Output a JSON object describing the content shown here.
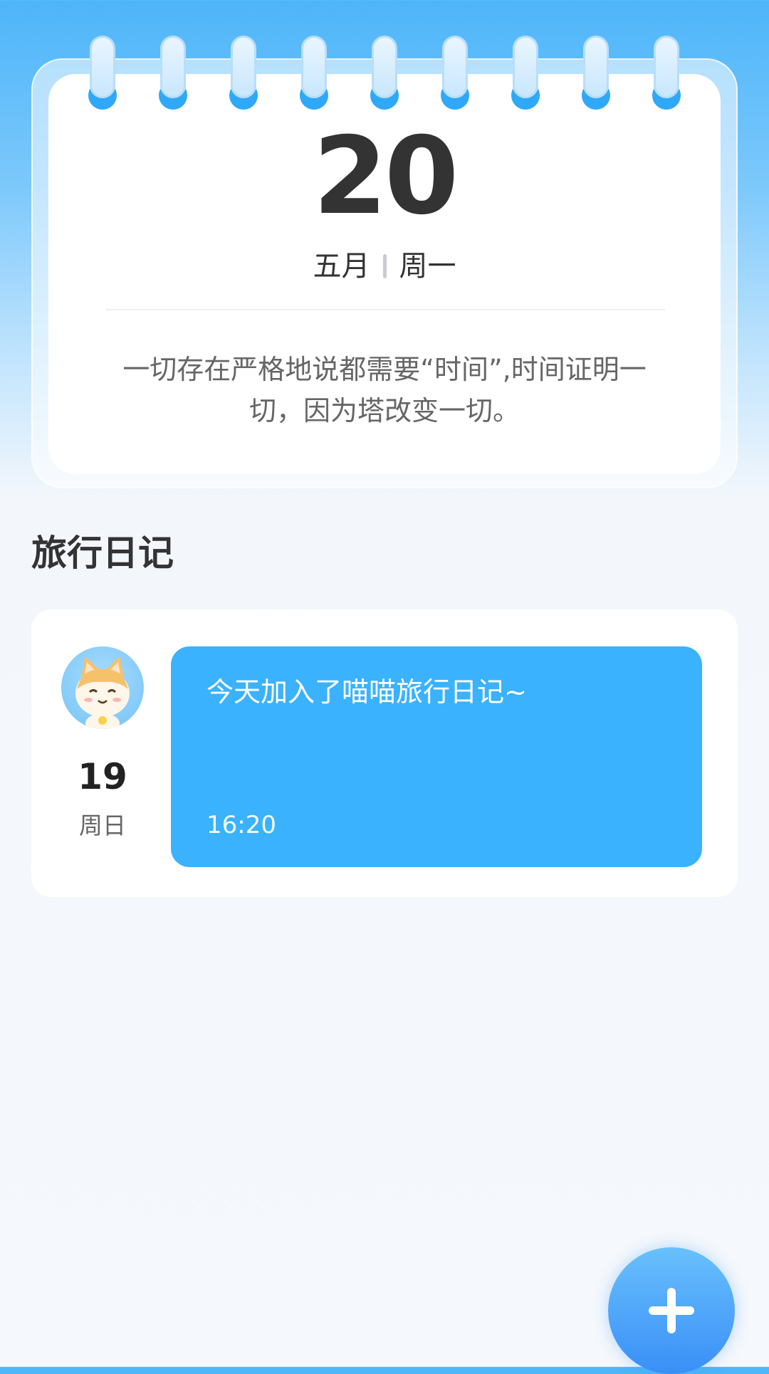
{
  "calendar": {
    "day": "20",
    "month": "五月",
    "weekday": "周一",
    "quote_line1": "一切存在严格地说都需要“时间”,时间证明一",
    "quote_line2": "切，因为塔改变一切。"
  },
  "diary": {
    "section_title": "旅行日记",
    "entries": [
      {
        "day": "19",
        "weekday": "周日",
        "text": "今天加入了喵喵旅行日记~",
        "time": "16:20",
        "avatar_icon": "cat-avatar-icon"
      }
    ]
  },
  "fab": {
    "icon": "plus-icon"
  },
  "colors": {
    "accent": "#3ab2fe",
    "header_gradient_top": "#4db5f9",
    "background": "#f5f8fc"
  }
}
